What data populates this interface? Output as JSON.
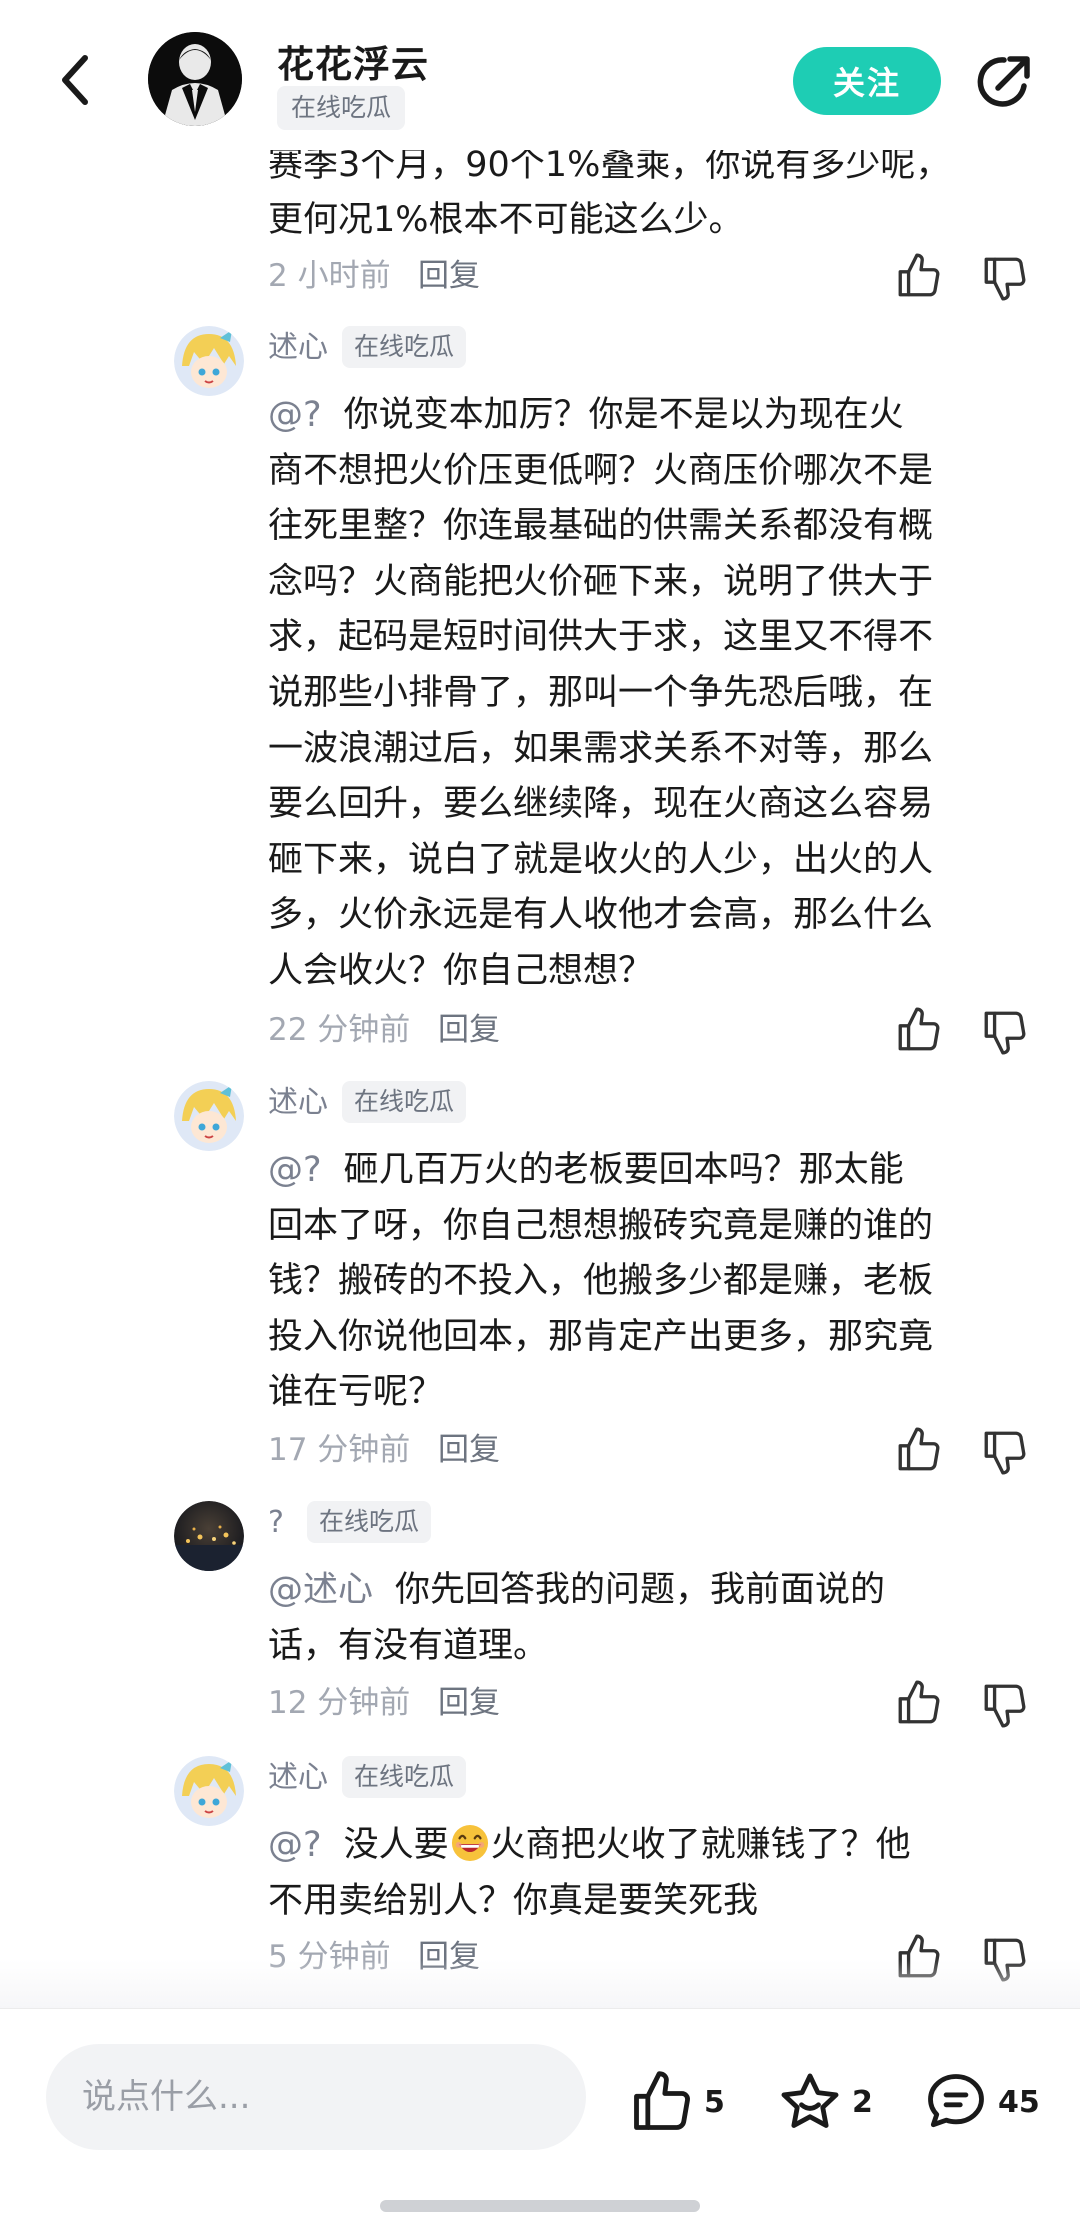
{
  "header": {
    "author_name": "花花浮云",
    "author_tag": "在线吃瓜",
    "follow_label": "关注"
  },
  "partial_comment": {
    "text_lines": [
      "赛季3个月，90个1%叠乘，你说有多少呢，",
      "更何况1%根本不可能这么少。"
    ],
    "time": "2 小时前",
    "reply_label": "回复"
  },
  "replies": [
    {
      "user": "述心",
      "tag": "在线吃瓜",
      "mention": "@?",
      "lines": [
        "你说变本加厉？你是不是以为现在火",
        "商不想把火价压更低啊？火商压价哪次不是",
        "往死里整？你连最基础的供需关系都没有概",
        "念吗？火商能把火价砸下来，说明了供大于",
        "求，起码是短时间供大于求，这里又不得不",
        "说那些小排骨了，那叫一个争先恐后哦，在",
        "一波浪潮过后，如果需求关系不对等，那么",
        "要么回升，要么继续降，现在火商这么容易",
        "砸下来，说白了就是收火的人少，出火的人",
        "多，火价永远是有人收他才会高，那么什么",
        "人会收火？你自己想想？"
      ],
      "time": "22 分钟前",
      "reply_label": "回复"
    },
    {
      "user": "述心",
      "tag": "在线吃瓜",
      "mention": "@?",
      "lines": [
        "砸几百万火的老板要回本吗？那太能",
        "回本了呀，你自己想想搬砖究竟是赚的谁的",
        "钱？搬砖的不投入，他搬多少都是赚，老板",
        "投入你说他回本，那肯定产出更多，那究竟",
        "谁在亏呢？"
      ],
      "time": "17 分钟前",
      "reply_label": "回复"
    },
    {
      "user": "?",
      "tag": "在线吃瓜",
      "mention": "@述心",
      "lines": [
        "你先回答我的问题，我前面说的",
        "话，有没有道理。"
      ],
      "time": "12 分钟前",
      "reply_label": "回复"
    },
    {
      "user": "述心",
      "tag": "在线吃瓜",
      "mention": "@?",
      "line1_before": "没人要",
      "line1_after": "火商把火收了就赚钱了？他",
      "line2": "不用卖给别人？你真是要笑死我",
      "time": "5 分钟前",
      "reply_label": "回复"
    }
  ],
  "bottom_bar": {
    "input_placeholder": "说点什么...",
    "like_count": "5",
    "favorite_count": "2",
    "comment_count": "45"
  },
  "icons": {
    "back": "chevron-left-icon",
    "share": "share-icon",
    "like": "thumbs-up-icon",
    "dislike": "thumbs-down-icon",
    "favorite": "star-icon",
    "comment": "comment-icon",
    "emoji": "laughing-emoji"
  },
  "colors": {
    "accent": "#1ecdb4",
    "muted_text": "#a3a8b2",
    "tag_bg": "#f1f2f4"
  }
}
